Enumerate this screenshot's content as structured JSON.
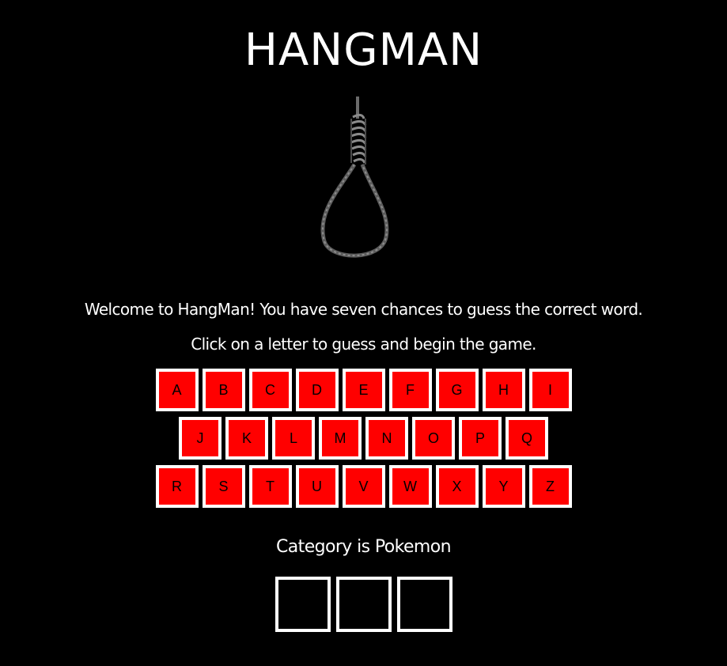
{
  "game": {
    "title": "HANGMAN",
    "welcome": "Welcome to HangMan! You have seven chances to guess the correct word.",
    "instruction": "Click on a letter to guess and begin the game.",
    "category": "Category is Pokemon"
  },
  "keyboard": {
    "rows": [
      [
        "A",
        "B",
        "C",
        "D",
        "E",
        "F",
        "G",
        "H",
        "I"
      ],
      [
        "J",
        "K",
        "L",
        "M",
        "N",
        "O",
        "P",
        "Q"
      ],
      [
        "R",
        "S",
        "T",
        "U",
        "V",
        "W",
        "X",
        "Y",
        "Z"
      ]
    ]
  },
  "word": {
    "slots": [
      "",
      "",
      ""
    ]
  },
  "colors": {
    "background": "#000000",
    "key_fill": "#ff0000",
    "key_border": "#ffffff",
    "text": "#ffffff"
  },
  "icons": {
    "hangman_figure": "noose-icon"
  }
}
